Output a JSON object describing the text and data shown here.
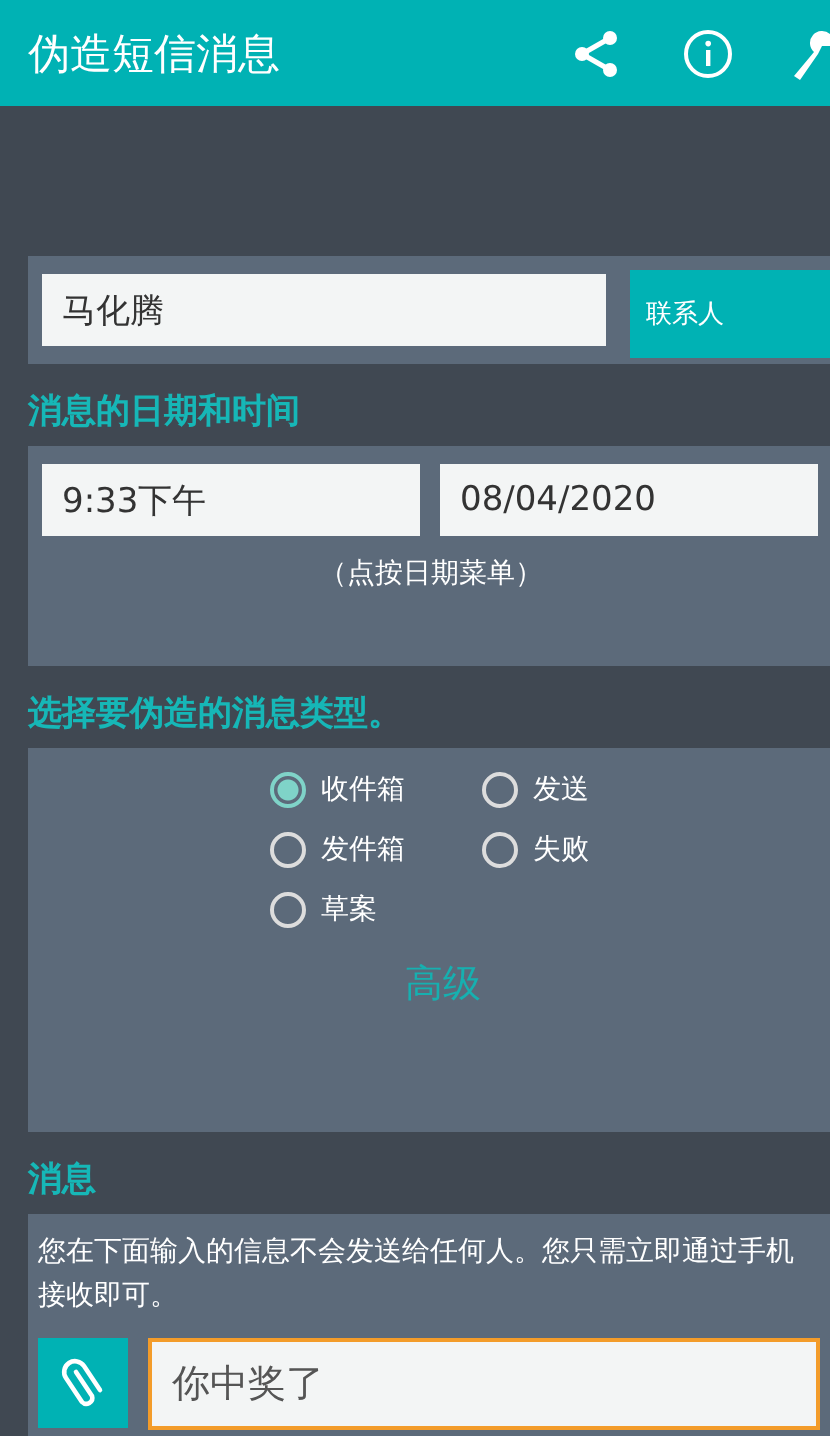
{
  "app_bar": {
    "title": "伪造短信消息"
  },
  "contact": {
    "value": "马化腾",
    "button": "联系人"
  },
  "datetime": {
    "heading": "消息的日期和时间",
    "time": "9:33下午",
    "date": "08/04/2020",
    "hint": "（点按日期菜单）"
  },
  "message_type": {
    "heading": "选择要伪造的消息类型。",
    "options": [
      {
        "label": "收件箱",
        "selected": true
      },
      {
        "label": "发送",
        "selected": false
      },
      {
        "label": "发件箱",
        "selected": false
      },
      {
        "label": "失败",
        "selected": false
      },
      {
        "label": "草案",
        "selected": false
      }
    ],
    "advanced": "高级"
  },
  "message": {
    "heading": "消息",
    "note": "您在下面输入的信息不会发送给任何人。您只需立即通过手机接收即可。",
    "value": "你中奖了"
  }
}
